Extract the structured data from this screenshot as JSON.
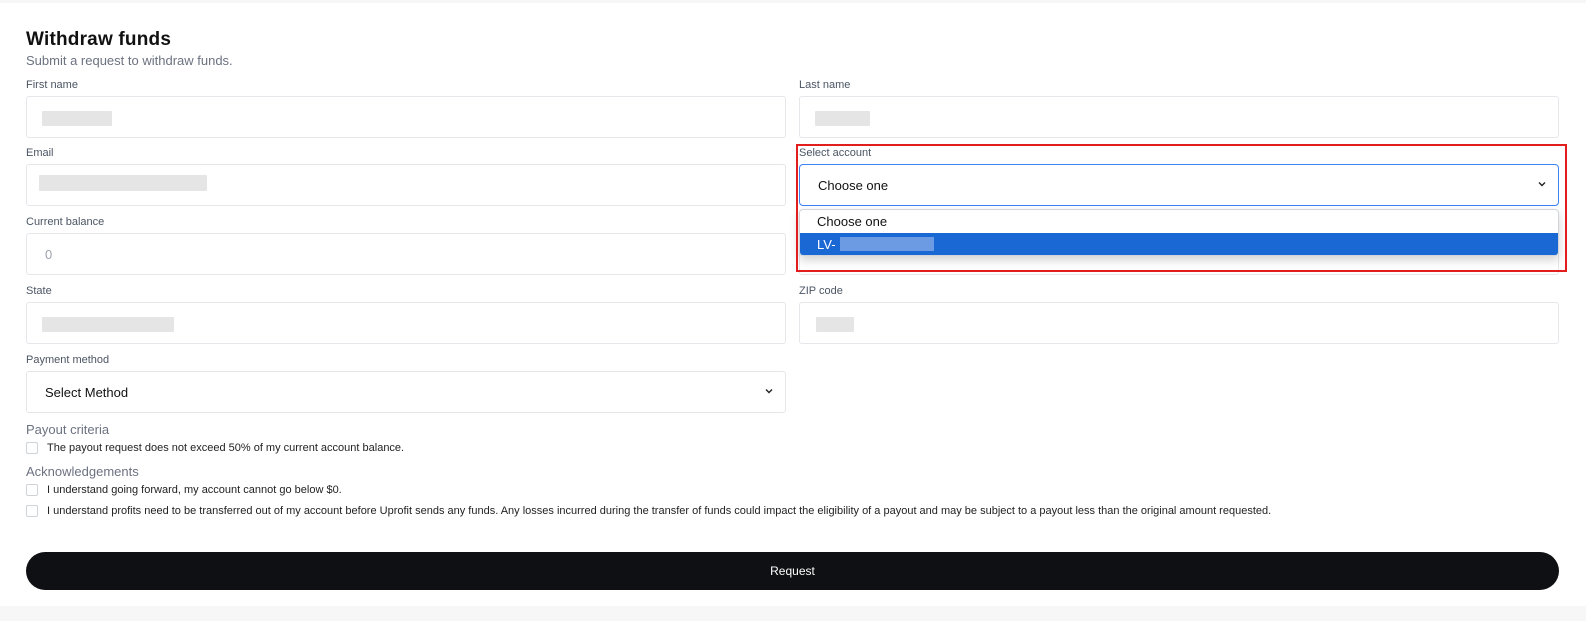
{
  "form": {
    "title": "Withdraw funds",
    "subtitle": "Submit a request to withdraw funds."
  },
  "fields": {
    "first_name": {
      "label": "First name"
    },
    "last_name": {
      "label": "Last name"
    },
    "email": {
      "label": "Email"
    },
    "select_account": {
      "label": "Select account",
      "value": "Choose one"
    },
    "current_balance": {
      "label": "Current balance",
      "value": "0"
    },
    "state": {
      "label": "State"
    },
    "zip_code": {
      "label": "ZIP code"
    },
    "payment_method": {
      "label": "Payment method",
      "value": "Select Method"
    }
  },
  "account_dropdown": {
    "options": [
      {
        "label": "Choose one"
      },
      {
        "label": "LV-"
      }
    ],
    "highlighted_index": 1
  },
  "payout_criteria": {
    "heading": "Payout criteria",
    "items": [
      "The payout request does not exceed 50% of my current account balance."
    ]
  },
  "acknowledgements": {
    "heading": "Acknowledgements",
    "items": [
      "I understand going forward, my account cannot go below $0.",
      "I understand profits need to be transferred out of my account before Uprofit sends any funds. Any losses incurred during the transfer of funds could impact the eligibility of a payout and may be subject to a payout less than the original amount requested."
    ]
  },
  "submit": {
    "label": "Request"
  },
  "colors": {
    "accent_button": "#0f1014",
    "highlight_option": "#1a68d4",
    "focus_border": "#3b82f6",
    "annotation_box": "#e11d1d"
  },
  "icons": {
    "select_chevron": "chevron-down-icon"
  }
}
